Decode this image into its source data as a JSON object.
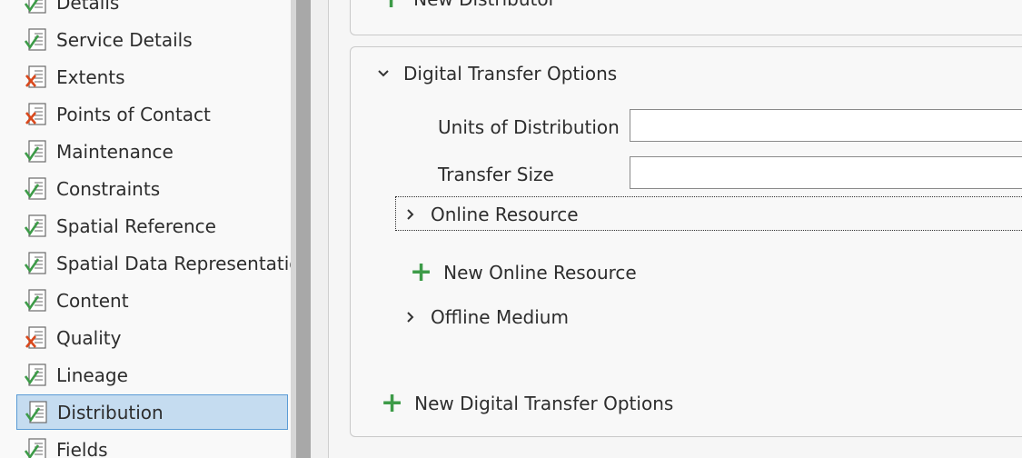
{
  "sidebar": {
    "items": [
      {
        "label": "Details",
        "status": "valid"
      },
      {
        "label": "Service Details",
        "status": "valid"
      },
      {
        "label": "Extents",
        "status": "invalid"
      },
      {
        "label": "Points of Contact",
        "status": "invalid"
      },
      {
        "label": "Maintenance",
        "status": "valid"
      },
      {
        "label": "Constraints",
        "status": "valid"
      },
      {
        "label": "Spatial Reference",
        "status": "valid"
      },
      {
        "label": "Spatial Data Representation",
        "status": "valid"
      },
      {
        "label": "Content",
        "status": "valid"
      },
      {
        "label": "Quality",
        "status": "invalid"
      },
      {
        "label": "Lineage",
        "status": "valid"
      },
      {
        "label": "Distribution",
        "status": "valid",
        "selected": true
      },
      {
        "label": "Fields",
        "status": "valid"
      }
    ]
  },
  "content": {
    "new_distributor_label": "New Distributor",
    "digital_transfer": {
      "header": "Digital Transfer Options",
      "units_label": "Units of Distribution",
      "units_value": "",
      "transfer_size_label": "Transfer Size",
      "transfer_size_value": "",
      "online_resource_label": "Online Resource",
      "new_online_resource_label": "New Online Resource",
      "offline_medium_label": "Offline Medium"
    },
    "new_digital_transfer_label": "New Digital Transfer Options"
  },
  "colors": {
    "accent_green": "#3d9b48",
    "error_red": "#d9481c",
    "selection_bg": "#c5dcf0",
    "selection_border": "#5a9bd5"
  }
}
